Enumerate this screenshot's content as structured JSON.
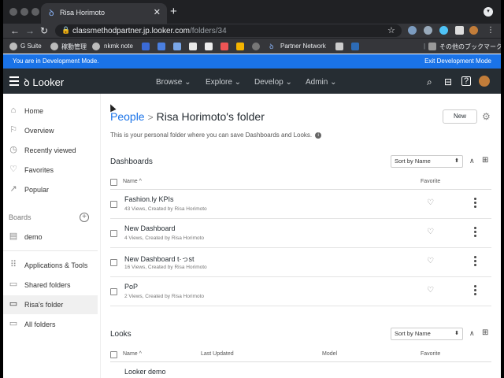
{
  "browser": {
    "tab_title": "Risa Horimoto",
    "new_tab": "+",
    "url_host": "classmethodpartner.jp.looker.com",
    "url_path": "/folders/34",
    "bookmarks": [
      "G Suite",
      "稼動管理",
      "nkmk note",
      "Partner Network",
      "その他のブックマーク"
    ]
  },
  "dev_banner": {
    "left_text": "You are in Development Mode.",
    "right_text": "Exit Development Mode"
  },
  "header": {
    "logo_text": "Looker",
    "menu": [
      {
        "label": "Browse ⌄"
      },
      {
        "label": "Explore ⌄"
      },
      {
        "label": "Develop ⌄"
      },
      {
        "label": "Admin ⌄"
      }
    ]
  },
  "sidebar": {
    "items": [
      {
        "label": "Home",
        "icon": "home-icon"
      },
      {
        "label": "Overview",
        "icon": "flag-icon"
      },
      {
        "label": "Recently viewed",
        "icon": "history-icon"
      },
      {
        "label": "Favorites",
        "icon": "heart-icon"
      },
      {
        "label": "Popular",
        "icon": "trending-icon"
      }
    ],
    "boards_label": "Boards",
    "boards": [
      {
        "label": "demo",
        "icon": "board-icon"
      }
    ],
    "folders": [
      {
        "label": "Applications & Tools",
        "icon": "apps-icon"
      },
      {
        "label": "Shared folders",
        "icon": "folder-icon"
      },
      {
        "label": "Risa's folder",
        "icon": "folder-icon",
        "active": true
      },
      {
        "label": "All folders",
        "icon": "folder-icon"
      }
    ]
  },
  "main": {
    "breadcrumb_link": "People",
    "breadcrumb_sep": ">",
    "title": "Risa Horimoto's folder",
    "new_button": "New",
    "description": "This is your personal folder where you can save Dashboards and Looks.",
    "dashboards": {
      "heading": "Dashboards",
      "sort": "Sort by Name",
      "col_name": "Name ^",
      "col_favorite": "Favorite",
      "rows": [
        {
          "name": "Fashion.ly KPIs",
          "meta": "43 Views, Created by Risa Horimoto"
        },
        {
          "name": "New Dashboard",
          "meta": "4 Views, Created by Risa Horimoto"
        },
        {
          "name": "New Dashboard t·っst",
          "meta": "16 Views, Created by Risa Horimoto"
        },
        {
          "name": "PoP",
          "meta": "2 Views, Created by Risa Horimoto"
        }
      ]
    },
    "looks": {
      "heading": "Looks",
      "sort": "Sort by Name",
      "col_name": "Name ^",
      "col_updated": "Last Updated",
      "col_model": "Model",
      "col_favorite": "Favorite",
      "rows": [
        {
          "name": "Looker demo"
        }
      ]
    }
  }
}
